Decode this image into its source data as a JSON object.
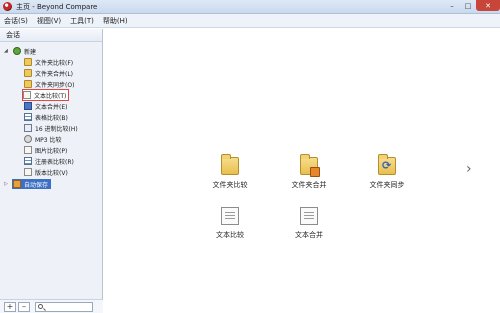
{
  "window": {
    "title": "主页 - Beyond Compare",
    "controls": {
      "minimize": "–",
      "maximize": "□",
      "close": "✕"
    }
  },
  "menubar": {
    "items": [
      "会话(S)",
      "视图(V)",
      "工具(T)",
      "帮助(H)"
    ]
  },
  "sidebar": {
    "header": "会话",
    "tree": {
      "root_label": "新建",
      "items": [
        {
          "label": "文件夹比较(F)",
          "icon": "folder-compare-icon"
        },
        {
          "label": "文件夹合并(L)",
          "icon": "folder-merge-icon"
        },
        {
          "label": "文件夹同步(O)",
          "icon": "folder-sync-icon"
        },
        {
          "label": "文本比较(T)",
          "icon": "text-compare-icon",
          "selected": true
        },
        {
          "label": "文本合并(E)",
          "icon": "text-merge-icon"
        },
        {
          "label": "表格比较(B)",
          "icon": "table-compare-icon"
        },
        {
          "label": "16 进制比较(H)",
          "icon": "hex-compare-icon"
        },
        {
          "label": "MP3 比较",
          "icon": "mp3-compare-icon"
        },
        {
          "label": "图片比较(P)",
          "icon": "picture-compare-icon"
        },
        {
          "label": "注册表比较(R)",
          "icon": "registry-compare-icon"
        },
        {
          "label": "版本比较(V)",
          "icon": "version-compare-icon"
        }
      ],
      "autosave_label": "自动保存"
    },
    "footer": {
      "add": "+",
      "remove": "–",
      "search_placeholder": ""
    }
  },
  "main": {
    "tiles": [
      {
        "label": "文件夹比较",
        "icon": "folder-compare-icon"
      },
      {
        "label": "文件夹合并",
        "icon": "folder-merge-icon"
      },
      {
        "label": "文件夹同步",
        "icon": "folder-sync-icon"
      },
      {
        "label": "文本比较",
        "icon": "text-compare-icon"
      },
      {
        "label": "文本合并",
        "icon": "text-merge-icon"
      }
    ],
    "next_arrow": "›"
  },
  "colors": {
    "selection_outline": "#e04848",
    "autosave_bg": "#3d6fc4",
    "close_btn": "#c8453a"
  }
}
